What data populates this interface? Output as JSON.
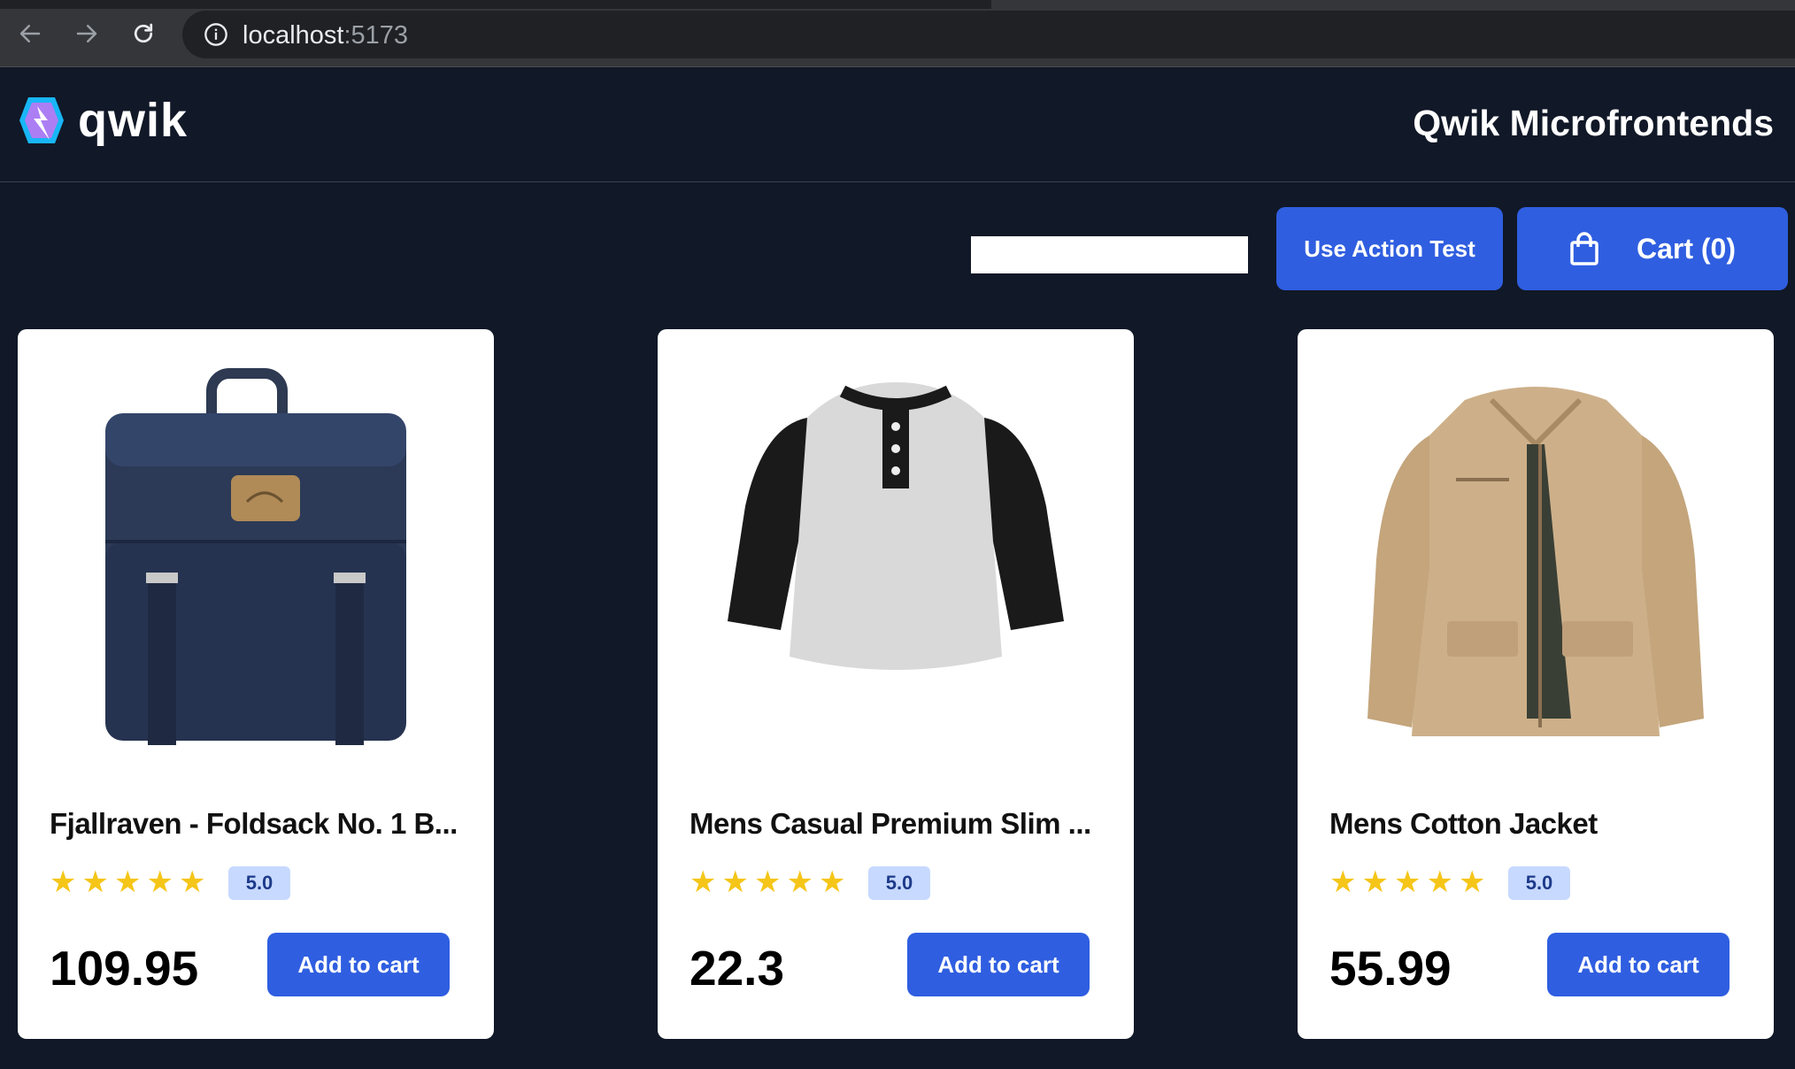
{
  "browser": {
    "url_host": "localhost",
    "url_port": ":5173"
  },
  "header": {
    "logo_text": "qwik",
    "title": "Qwik Microfrontends"
  },
  "toolbar": {
    "field_value": "",
    "use_action_label": "Use Action Test",
    "cart_label": "Cart (0)"
  },
  "products": [
    {
      "title": "Fjallraven - Foldsack No. 1 B...",
      "rating": "5.0",
      "stars": 5,
      "price": "109.95",
      "button": "Add to cart"
    },
    {
      "title": "Mens Casual Premium Slim ...",
      "rating": "5.0",
      "stars": 5,
      "price": "22.3",
      "button": "Add to cart"
    },
    {
      "title": "Mens Cotton Jacket",
      "rating": "5.0",
      "stars": 5,
      "price": "55.99",
      "button": "Add to cart"
    }
  ],
  "colors": {
    "page_bg": "#111827",
    "primary": "#2f5ee0",
    "star": "#f5c518",
    "rating_bg": "#c7d9ff"
  },
  "icons": [
    "back-arrow-icon",
    "forward-arrow-icon",
    "reload-icon",
    "info-icon",
    "qwik-logo-icon",
    "shopping-bag-icon",
    "star-icon"
  ]
}
